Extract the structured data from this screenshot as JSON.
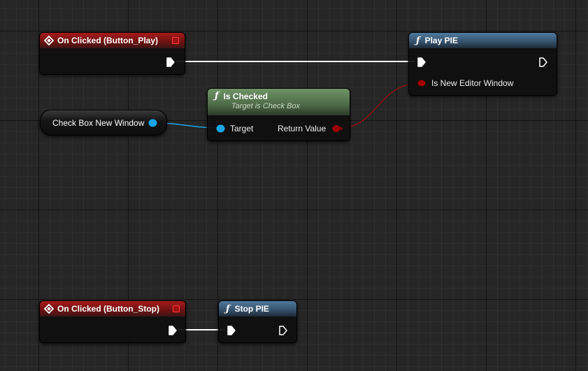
{
  "colors": {
    "exec_wire": "#ffffff",
    "object_pin": "#1aa6e8",
    "bool_pin": "#a00000",
    "event_header": "#a81a1a",
    "function_header": "#4f7a9e",
    "pure_function_header": "#6f9466"
  },
  "nodes": {
    "on_clicked_play": {
      "title": "On Clicked (Button_Play)",
      "icon": "event-diamond-icon"
    },
    "play_pie": {
      "title": "Play PIE",
      "icon": "function-icon",
      "input_label": "Is New Editor Window"
    },
    "is_checked": {
      "title": "Is Checked",
      "subtitle": "Target is Check Box",
      "icon": "function-icon",
      "input_label": "Target",
      "output_label": "Return Value"
    },
    "check_box_var": {
      "label": "Check Box New Window"
    },
    "on_clicked_stop": {
      "title": "On Clicked (Button_Stop)",
      "icon": "event-diamond-icon"
    },
    "stop_pie": {
      "title": "Stop PIE",
      "icon": "function-icon"
    }
  }
}
